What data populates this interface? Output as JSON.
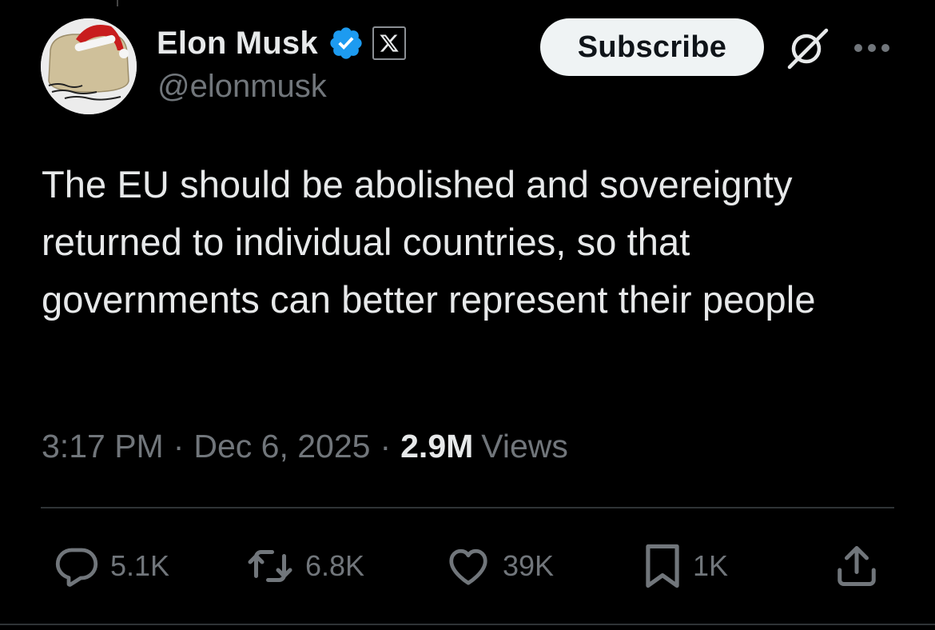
{
  "author": {
    "display_name": "Elon Musk",
    "handle": "@elonmusk",
    "verified_badge": "verified-checkmark-icon",
    "affiliation_badge": "x-logo-icon",
    "avatar": "avatar-image"
  },
  "header": {
    "subscribe_label": "Subscribe",
    "grok_icon": "grok-icon",
    "more_icon": "more-dots-icon"
  },
  "tweet": {
    "text": "The EU should be abolished and sovereignty returned to individual countries, so that governments can better represent their people"
  },
  "meta": {
    "time": "3:17 PM",
    "separator": "·",
    "date": "Dec 6, 2025",
    "views_count": "2.9M",
    "views_label": "Views"
  },
  "actions": {
    "reply": {
      "icon": "reply-icon",
      "count": "5.1K"
    },
    "repost": {
      "icon": "repost-icon",
      "count": "6.8K"
    },
    "like": {
      "icon": "heart-icon",
      "count": "39K"
    },
    "bookmark": {
      "icon": "bookmark-icon",
      "count": "1K"
    },
    "share": {
      "icon": "share-icon"
    }
  },
  "colors": {
    "background": "#000000",
    "primary_text": "#e7e9ea",
    "secondary_text": "#71767b",
    "verified_blue": "#1d9bf0",
    "button_bg": "#eff3f4",
    "divider": "#2f3336"
  }
}
